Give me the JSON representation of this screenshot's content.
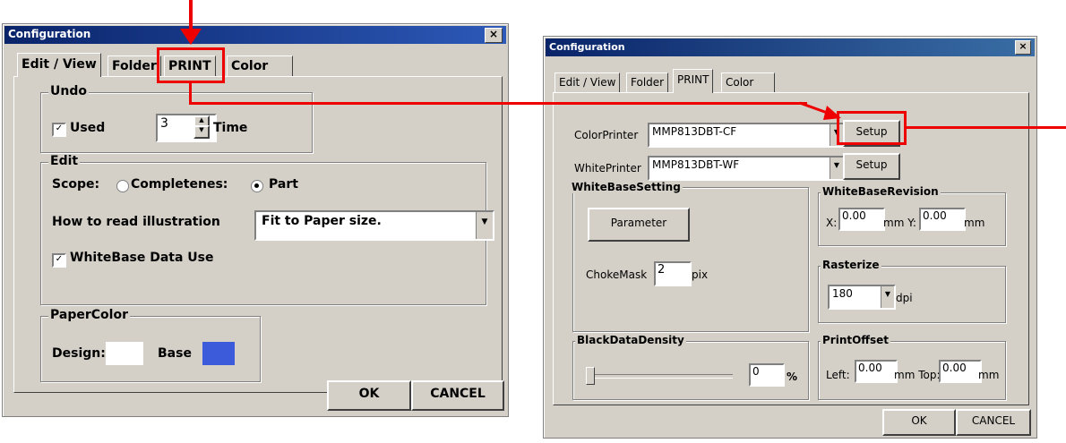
{
  "left_dialog": {
    "title": "Configuration",
    "close_glyph": "×",
    "tabs": [
      "Edit / View",
      "Folder",
      "PRINT",
      "Color"
    ],
    "undo": {
      "legend": "Undo",
      "used_label": "Used",
      "used_checked": true,
      "times_value": "3",
      "time_label": "Time"
    },
    "edit": {
      "legend": "Edit",
      "scope_label": "Scope:",
      "scope_options": [
        "Completenes:",
        "Part"
      ],
      "scope_selected": "Part",
      "read_label": "How to read illustration",
      "read_value": "Fit to Paper size.",
      "whitebase_label": "WhiteBase Data Use",
      "whitebase_checked": true
    },
    "paper_color": {
      "legend": "PaperColor",
      "design_label": "Design:",
      "design_color": "#ffffff",
      "base_label": "Base",
      "base_color": "#3b5bdb"
    },
    "ok_label": "OK",
    "cancel_label": "CANCEL"
  },
  "right_dialog": {
    "title": "Configuration",
    "close_glyph": "×",
    "tabs": [
      "Edit / View",
      "Folder",
      "PRINT",
      "Color"
    ],
    "color_printer_label": "ColorPrinter",
    "color_printer_value": "MMP813DBT-CF",
    "white_printer_label": "WhitePrinter",
    "white_printer_value": "MMP813DBT-WF",
    "setup_label": "Setup",
    "whitebase_setting": {
      "legend": "WhiteBaseSetting",
      "parameter_label": "Parameter",
      "chokemask_label": "ChokeMask",
      "chokemask_value": "2",
      "pix_label": "pix"
    },
    "whitebase_revision": {
      "legend": "WhiteBaseRevision",
      "x_label": "X:",
      "x_value": "0.00",
      "mm_y_label": "mm Y:",
      "y_value": "0.00",
      "mm_label": "mm"
    },
    "rasterize": {
      "legend": "Rasterize",
      "dpi_value": "180",
      "dpi_label": "dpi"
    },
    "black_density": {
      "legend": "BlackDataDensity",
      "value": "0",
      "percent_label": "%",
      "level": 0
    },
    "print_offset": {
      "legend": "PrintOffset",
      "left_label": "Left:",
      "left_value": "0.00",
      "mm_top_label": "mm Top:",
      "top_value": "0.00",
      "mm_label": "mm"
    },
    "ok_label": "OK",
    "cancel_label": "CANCEL"
  },
  "annotation_color": "#ee0000",
  "dropdown_glyph": "▼",
  "check_glyph": "✓"
}
